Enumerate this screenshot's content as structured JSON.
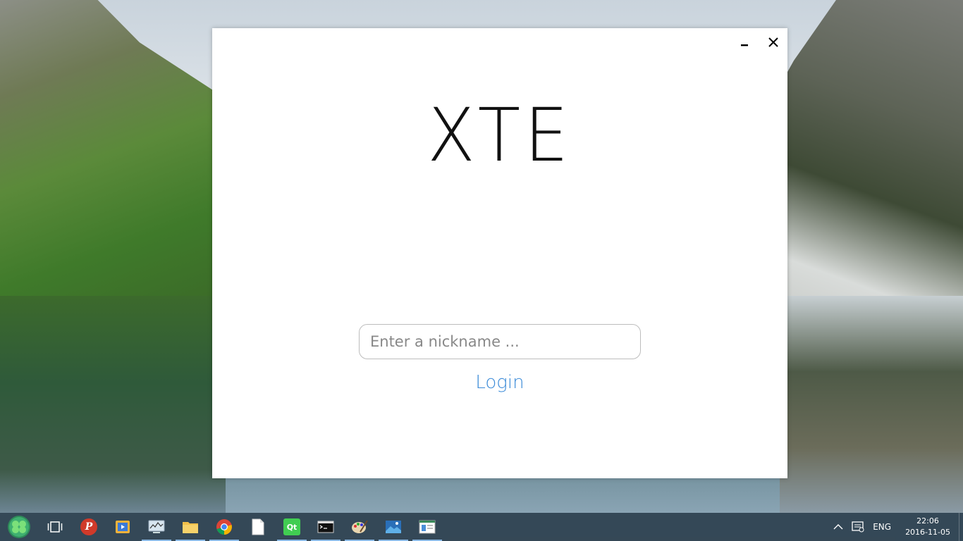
{
  "window": {
    "title": "XTE",
    "minimize_icon": "minimize-icon",
    "close_icon": "close-icon"
  },
  "login": {
    "nickname_placeholder": "Enter a nickname ...",
    "nickname_value": "",
    "login_label": "Login",
    "accent_color": "#3a8ad8"
  },
  "taskbar": {
    "apps": [
      {
        "name": "start-button",
        "icon": "clover-icon"
      },
      {
        "name": "task-view",
        "icon": "task-view-icon"
      },
      {
        "name": "psiphon",
        "icon": "psiphon-icon",
        "glyph": "P"
      },
      {
        "name": "media-player",
        "icon": "media-player-icon"
      },
      {
        "name": "app-network",
        "icon": "network-monitor-icon",
        "running": true
      },
      {
        "name": "file-explorer",
        "icon": "folder-icon",
        "running": true
      },
      {
        "name": "chrome",
        "icon": "chrome-icon",
        "running": true
      },
      {
        "name": "notepad",
        "icon": "document-icon"
      },
      {
        "name": "qt-creator",
        "icon": "qt-icon",
        "glyph": "Qt",
        "running": true
      },
      {
        "name": "terminal",
        "icon": "terminal-icon",
        "running": true
      },
      {
        "name": "paint",
        "icon": "paint-icon",
        "running": true
      },
      {
        "name": "photos",
        "icon": "photos-icon",
        "running": true
      },
      {
        "name": "app-window",
        "icon": "window-app-icon",
        "running": true
      }
    ],
    "tray": {
      "chevron_icon": "chevron-up-icon",
      "notification_icon": "message-icon",
      "language": "ENG",
      "time": "22:06",
      "date": "2016-11-05"
    }
  }
}
